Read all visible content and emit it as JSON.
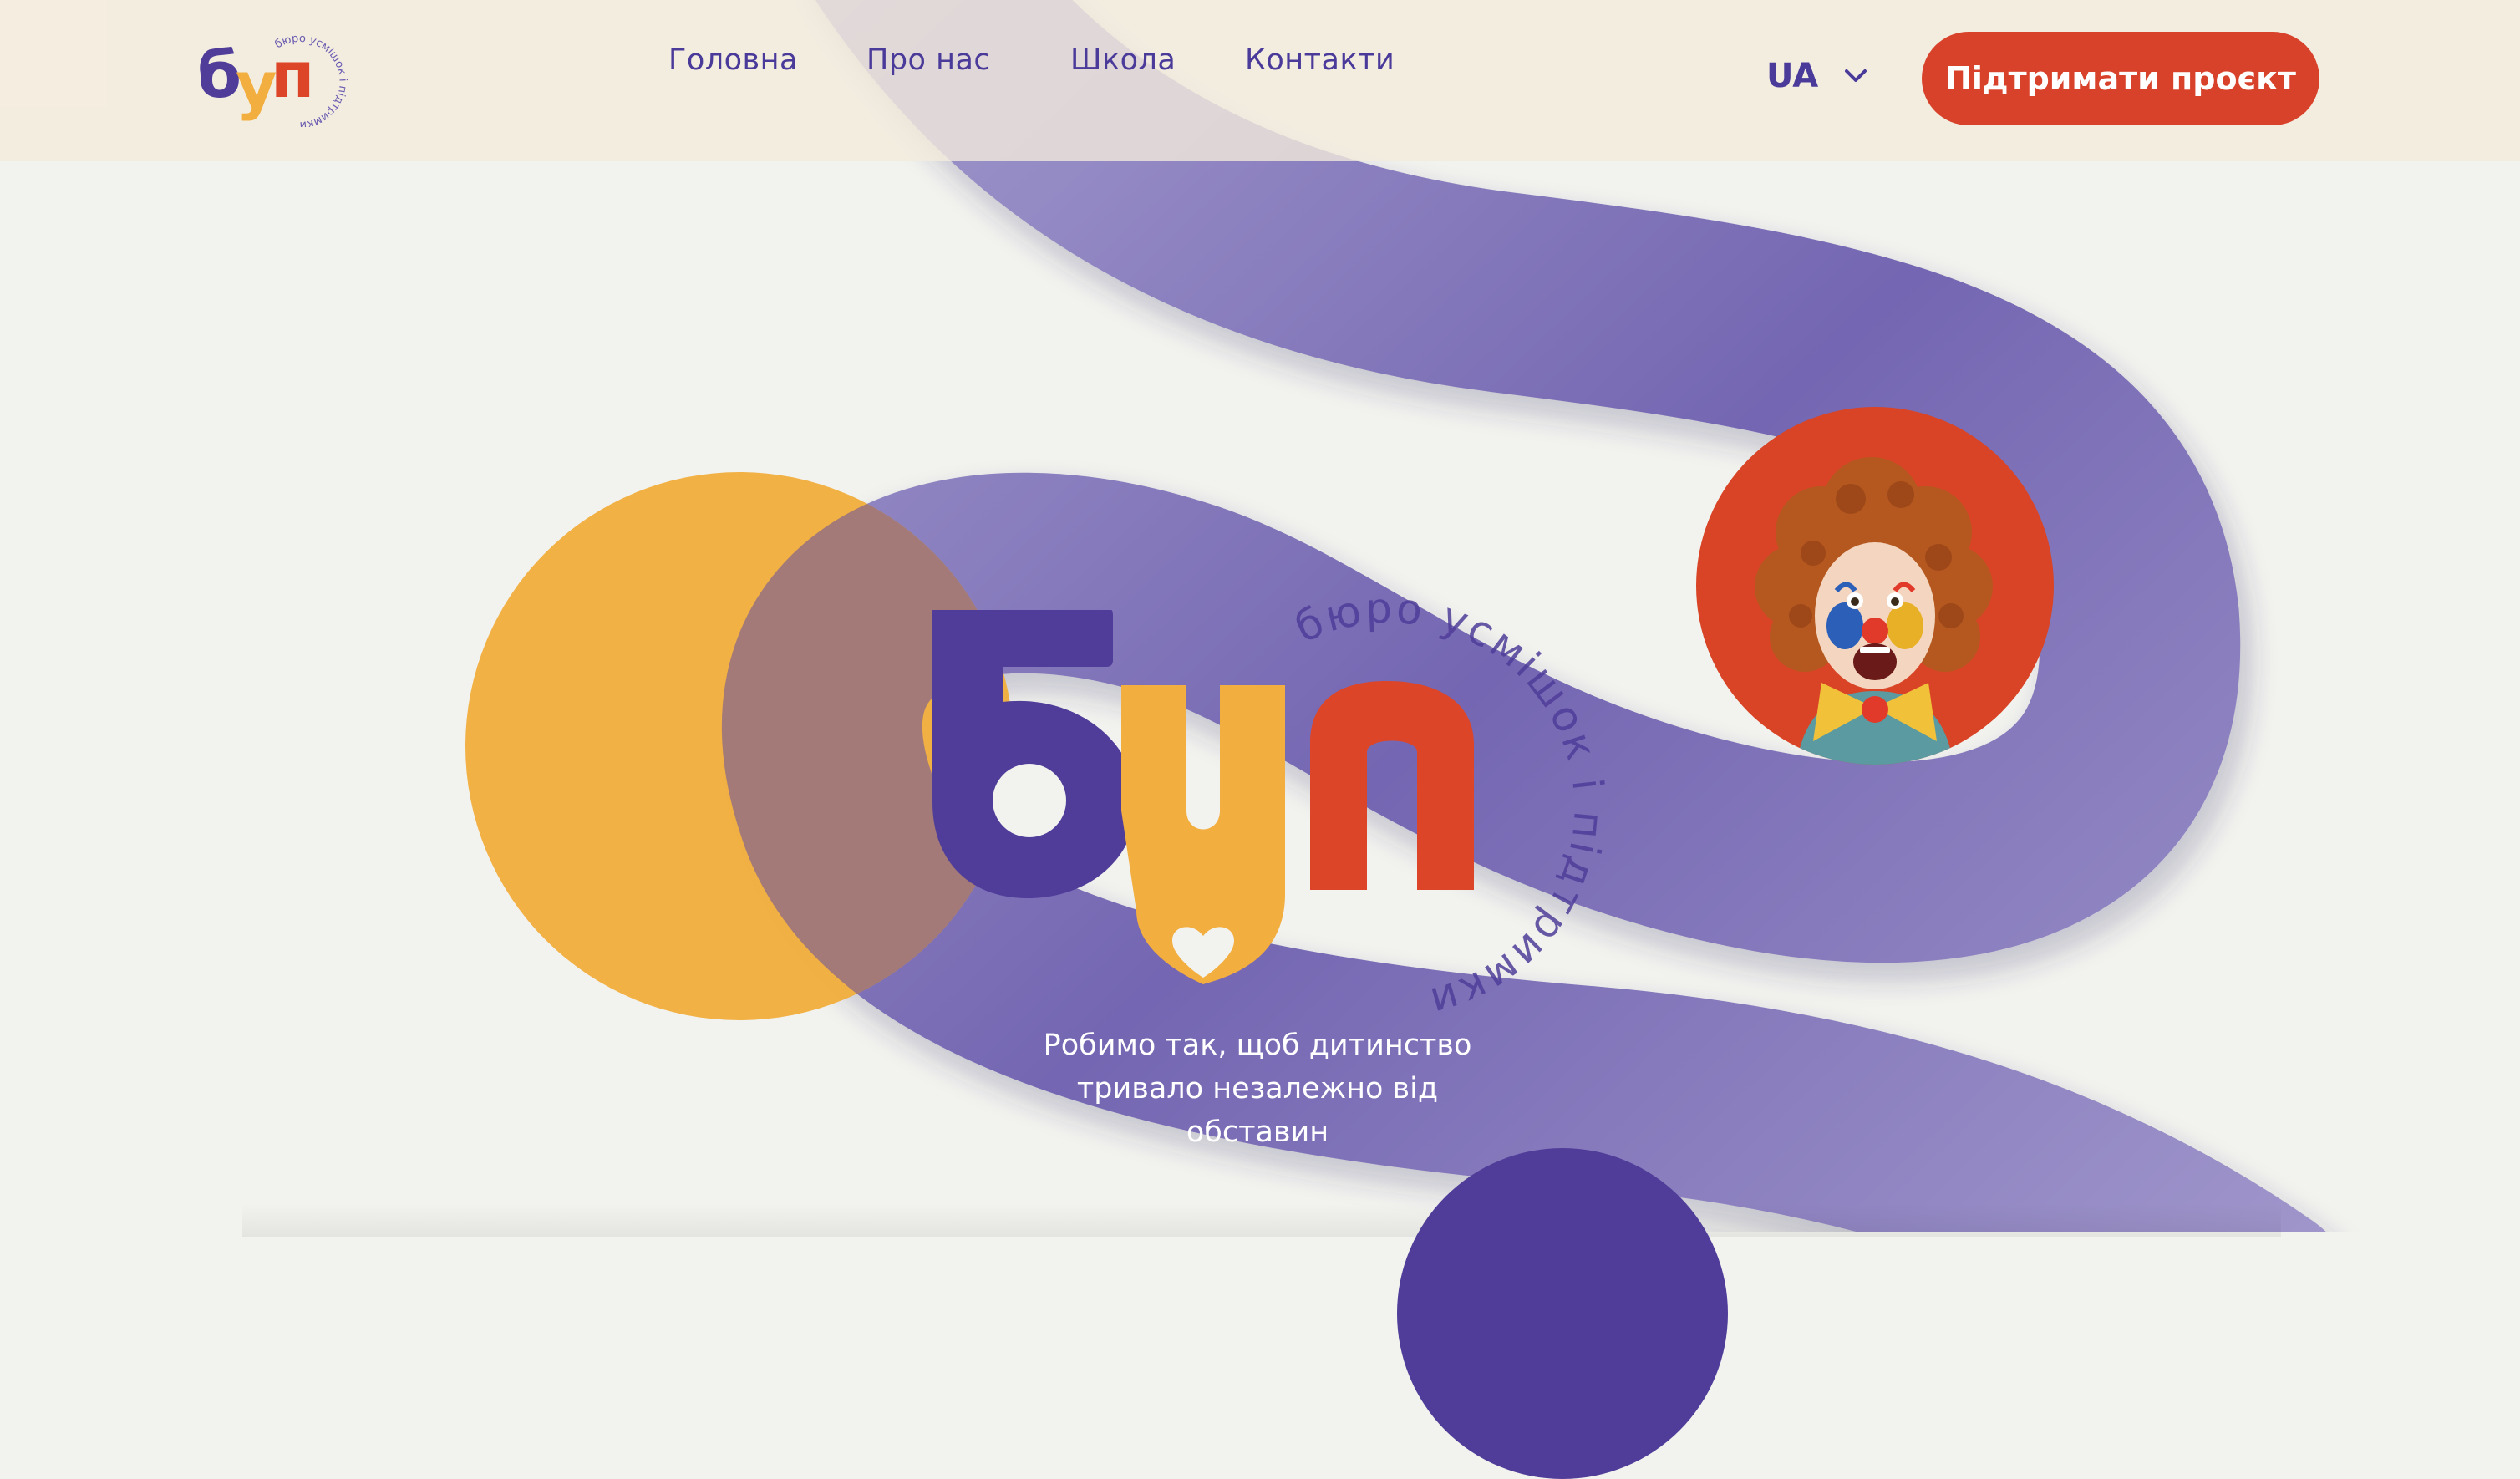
{
  "header": {
    "logo_word": "буп",
    "logo_ring_text": "бюро усмішок і підтримки",
    "nav": [
      {
        "label": "Головна"
      },
      {
        "label": "Про нас"
      },
      {
        "label": "Школа"
      },
      {
        "label": "Контакти"
      }
    ],
    "language": "UA",
    "support_label": "Підтримати проєкт"
  },
  "hero": {
    "logo_word": "буп",
    "logo_ring_text": "бюро усмішок і підтримки",
    "tagline_lines": [
      "Робимо так, щоб дитинство",
      "тривало незалежно від",
      "обставин"
    ]
  },
  "colors": {
    "brand_purple": "#4f3d99",
    "brand_orange": "#f2ae3f",
    "brand_red": "#dd4528",
    "header_bg": "#f4ecdc",
    "page_bg": "#f2f2ee",
    "ribbon": "#7a6cb6"
  },
  "icons": {
    "language_toggle": "chevron-down-icon"
  }
}
